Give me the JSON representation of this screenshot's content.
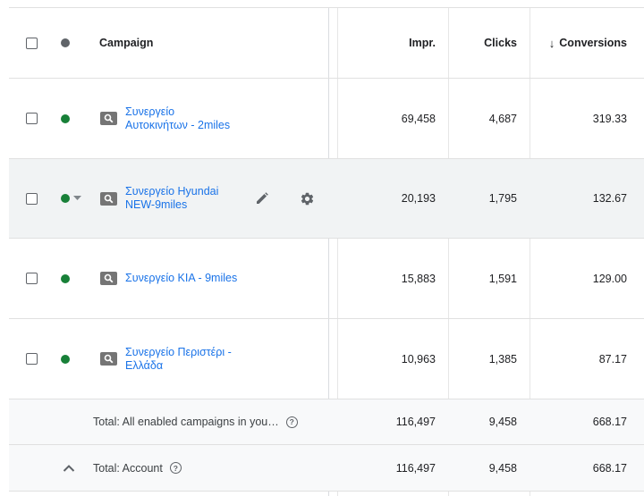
{
  "header": {
    "campaign_label": "Campaign",
    "impr_label": "Impr.",
    "clicks_label": "Clicks",
    "conversions_label": "Conversions",
    "sort_arrow": "↓"
  },
  "rows": [
    {
      "campaign_line1": "Συνεργείο",
      "campaign_line2": "Αυτοκινήτων - 2miles",
      "impr": "69,458",
      "clicks": "4,687",
      "conversions": "319.33",
      "status_color": "#188038"
    },
    {
      "campaign_line1": "Συνεργείο Hyundai",
      "campaign_line2": "NEW-9miles",
      "impr": "20,193",
      "clicks": "1,795",
      "conversions": "132.67",
      "status_color": "#188038"
    },
    {
      "campaign_line1": "Συνεργείο KIA - 9miles",
      "campaign_line2": "",
      "impr": "15,883",
      "clicks": "1,591",
      "conversions": "129.00",
      "status_color": "#188038"
    },
    {
      "campaign_line1": "Συνεργείο Περιστέρι -",
      "campaign_line2": "Ελλάδα",
      "impr": "10,963",
      "clicks": "1,385",
      "conversions": "87.17",
      "status_color": "#188038"
    }
  ],
  "totals": [
    {
      "label": "Total: All enabled campaigns in you…",
      "impr": "116,497",
      "clicks": "9,458",
      "conversions": "668.17"
    },
    {
      "label": "Total: Account",
      "impr": "116,497",
      "clicks": "9,458",
      "conversions": "668.17"
    }
  ],
  "icons": {
    "campaign_type": "search-campaign-icon",
    "edit": "pencil-icon",
    "settings": "gear-icon",
    "help": "help-icon",
    "collapse": "chevron-up-icon",
    "status_menu": "caret-down-icon"
  },
  "help_glyph": "?",
  "colors": {
    "link": "#1a73e8",
    "enabled": "#188038",
    "hover_row": "#f1f3f4",
    "total_row": "#f8f9fa"
  }
}
